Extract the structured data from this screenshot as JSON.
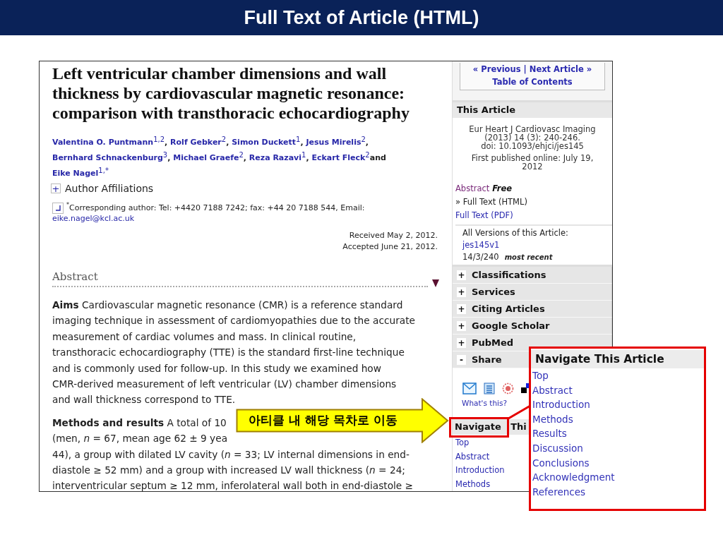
{
  "slide": {
    "title": "Full Text of Article (HTML)"
  },
  "article": {
    "title": "Left ventricular chamber dimensions and wall thickness by cardiovascular magnetic resonance: comparison with transthoracic echocardiography",
    "authors": [
      {
        "name": "Valentina O. Puntmann",
        "sup": "1,2",
        "after": ","
      },
      {
        "name": "Rolf Gebker",
        "sup": "2",
        "after": ","
      },
      {
        "name": "Simon Duckett",
        "sup": "1",
        "after": ","
      },
      {
        "name": "Jesus Mirelis",
        "sup": "2",
        "after": ","
      },
      {
        "name": "Bernhard Schnackenburg",
        "sup": "3",
        "after": ","
      },
      {
        "name": "Michael Graefe",
        "sup": "2",
        "after": ","
      },
      {
        "name": "Reza Razavi",
        "sup": "1",
        "after": ","
      },
      {
        "name": "Eckart Fleck",
        "sup": "2",
        "after": "and"
      },
      {
        "name": "Eike Nagel",
        "sup": "1,*"
      }
    ],
    "affiliations": {
      "toggle": "+",
      "label": "Author Affiliations"
    },
    "corresponding": {
      "mark": "*",
      "text": "Corresponding author: Tel: +4420 7188 7242; fax: +44 20 7188 544, Email:",
      "email": "eike.nagel@kcl.ac.uk"
    },
    "dates": [
      "Received May 2, 2012.",
      "Accepted June 21, 2012."
    ],
    "abstract_heading": "Abstract",
    "paragraphs": [
      {
        "lines": [
          "**Aims** Cardiovascular magnetic resonance (CMR) is a reference standard",
          "imaging technique in assessment of cardiomyopathies due to the accurate",
          "measurement of cardiac volumes and mass. In clinical routine,",
          "transthoracic echocardiography (TTE) is the standard first-line technique",
          "and is commonly used for follow-up. In this study we examined how",
          "CMR-derived measurement of left ventricular (LV) chamber dimensions",
          "and wall thickness correspond to TTE."
        ]
      },
      {
        "lines": [
          "**Methods and results** A total of 10",
          "(men, *n* = 67, mean age 62 ± 9 yea",
          "44), a group with dilated LV cavity (*n* = 33; LV internal dimensions in end-",
          "diastole ≥ 52 mm) and a group with increased LV wall thickness (*n* = 24;",
          "interventricular septum ≥ 12 mm, inferolateral wall both in end-diastole ≥"
        ]
      }
    ]
  },
  "sidebar": {
    "article_nav": {
      "previous": "« Previous",
      "separator": "|",
      "next": "Next Article »",
      "toc": "Table of Contents"
    },
    "this_article": {
      "heading": "This Article",
      "citation": [
        "Eur Heart J Cardiovasc Imaging",
        "(2013) 14 (3): 240-246.",
        "doi: 10.1093/ehjci/jes145"
      ],
      "published": [
        "First published online: July 19,",
        "2012"
      ]
    },
    "formats": [
      {
        "kind": "visited",
        "label": "Abstract",
        "badge": "Free"
      },
      {
        "kind": "current",
        "label": "» Full Text (HTML)"
      },
      {
        "kind": "link",
        "label": "Full Text (PDF)"
      }
    ],
    "versions": {
      "heading": "All Versions of this Article:",
      "id": "jes145v1",
      "issue": "14/3/240",
      "note": "most recent"
    },
    "panels": [
      {
        "toggle": "+",
        "label": "Classifications"
      },
      {
        "toggle": "+",
        "label": "Services"
      },
      {
        "toggle": "+",
        "label": "Citing Articles"
      },
      {
        "toggle": "+",
        "label": "Google Scholar"
      },
      {
        "toggle": "+",
        "label": "PubMed"
      },
      {
        "toggle": "-",
        "label": "Share"
      }
    ],
    "share_help": "What's this?",
    "navigate": {
      "heading": "Navigate Thi",
      "links": [
        "Top",
        "Abstract",
        "Introduction",
        "Methods"
      ]
    }
  },
  "callout": {
    "text": "아티클 내 해당 목차로 이동"
  },
  "zoom_panel": {
    "heading": "Navigate This Article",
    "links": [
      "Top",
      "Abstract",
      "Introduction",
      "Methods",
      "Results",
      "Discussion",
      "Conclusions",
      "Acknowledgment",
      "References"
    ]
  }
}
